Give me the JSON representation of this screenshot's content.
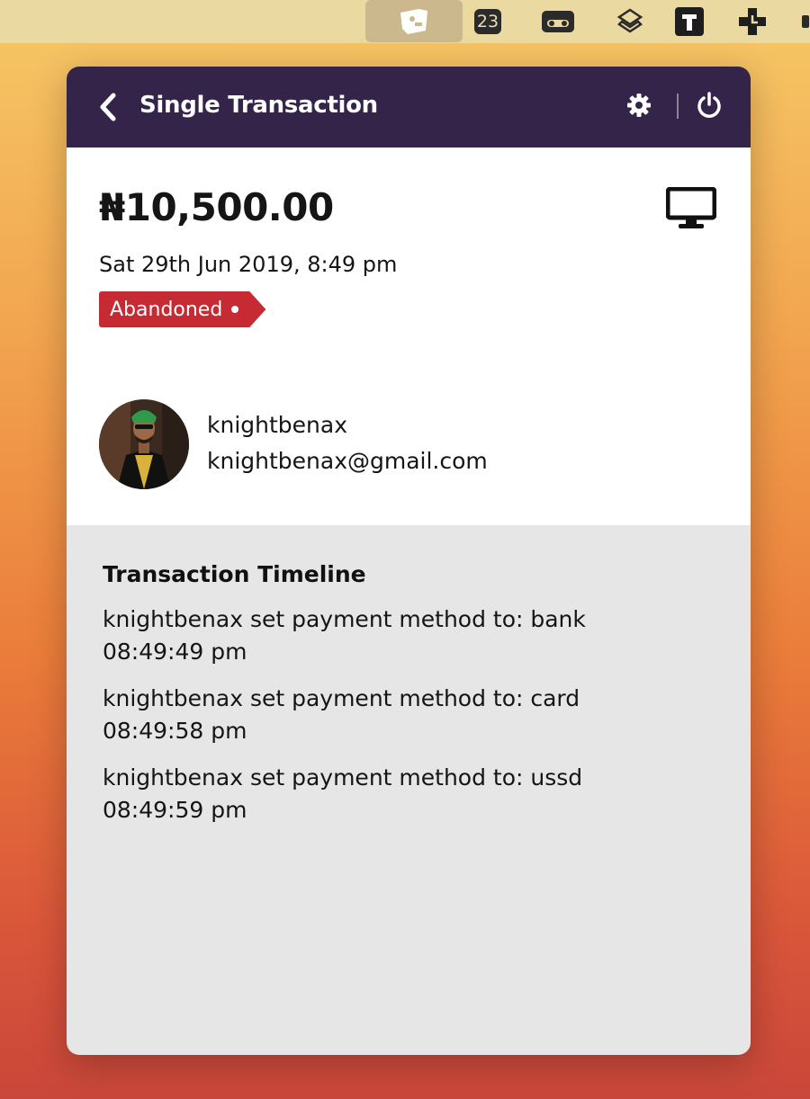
{
  "menubar": {
    "items": [
      {
        "icon": "app-tag-icon",
        "active": true
      },
      {
        "icon": "calendar-badge-icon",
        "badge": "23"
      },
      {
        "icon": "cassette-icon"
      },
      {
        "icon": "layers-icon"
      },
      {
        "icon": "t-app-icon"
      },
      {
        "icon": "plus-cross-icon"
      }
    ]
  },
  "header": {
    "title": "Single Transaction",
    "back_icon": "chevron-left-icon",
    "settings_icon": "gear-icon",
    "power_icon": "power-icon",
    "background": "#35244a"
  },
  "transaction": {
    "amount": "₦10,500.00",
    "datetime": "Sat 29th Jun 2019, 8:49 pm",
    "status": "Abandoned",
    "status_color": "#c62a32",
    "channel_icon": "desktop-monitor-icon"
  },
  "customer": {
    "username": "knightbenax",
    "email": "knightbenax@gmail.com"
  },
  "timeline": {
    "title": "Transaction Timeline",
    "events": [
      {
        "text": "knightbenax set payment method to: bank",
        "time": "08:49:49 pm"
      },
      {
        "text": "knightbenax set payment method to: card",
        "time": "08:49:58 pm"
      },
      {
        "text": "knightbenax set payment method to: ussd",
        "time": "08:49:59 pm"
      }
    ]
  }
}
